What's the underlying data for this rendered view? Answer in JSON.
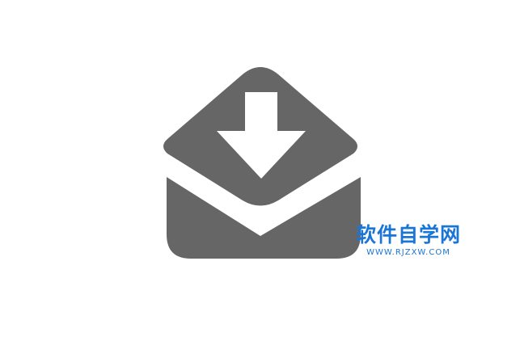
{
  "icon": {
    "name": "inbox-download-icon",
    "colors": {
      "shape": "#666666",
      "arrow": "#ffffff"
    }
  },
  "watermark": {
    "title": "软件自学网",
    "url": "WWW.RJZXW.COM",
    "colors": {
      "title": "#1a75d6",
      "url": "#1a75d6"
    }
  }
}
